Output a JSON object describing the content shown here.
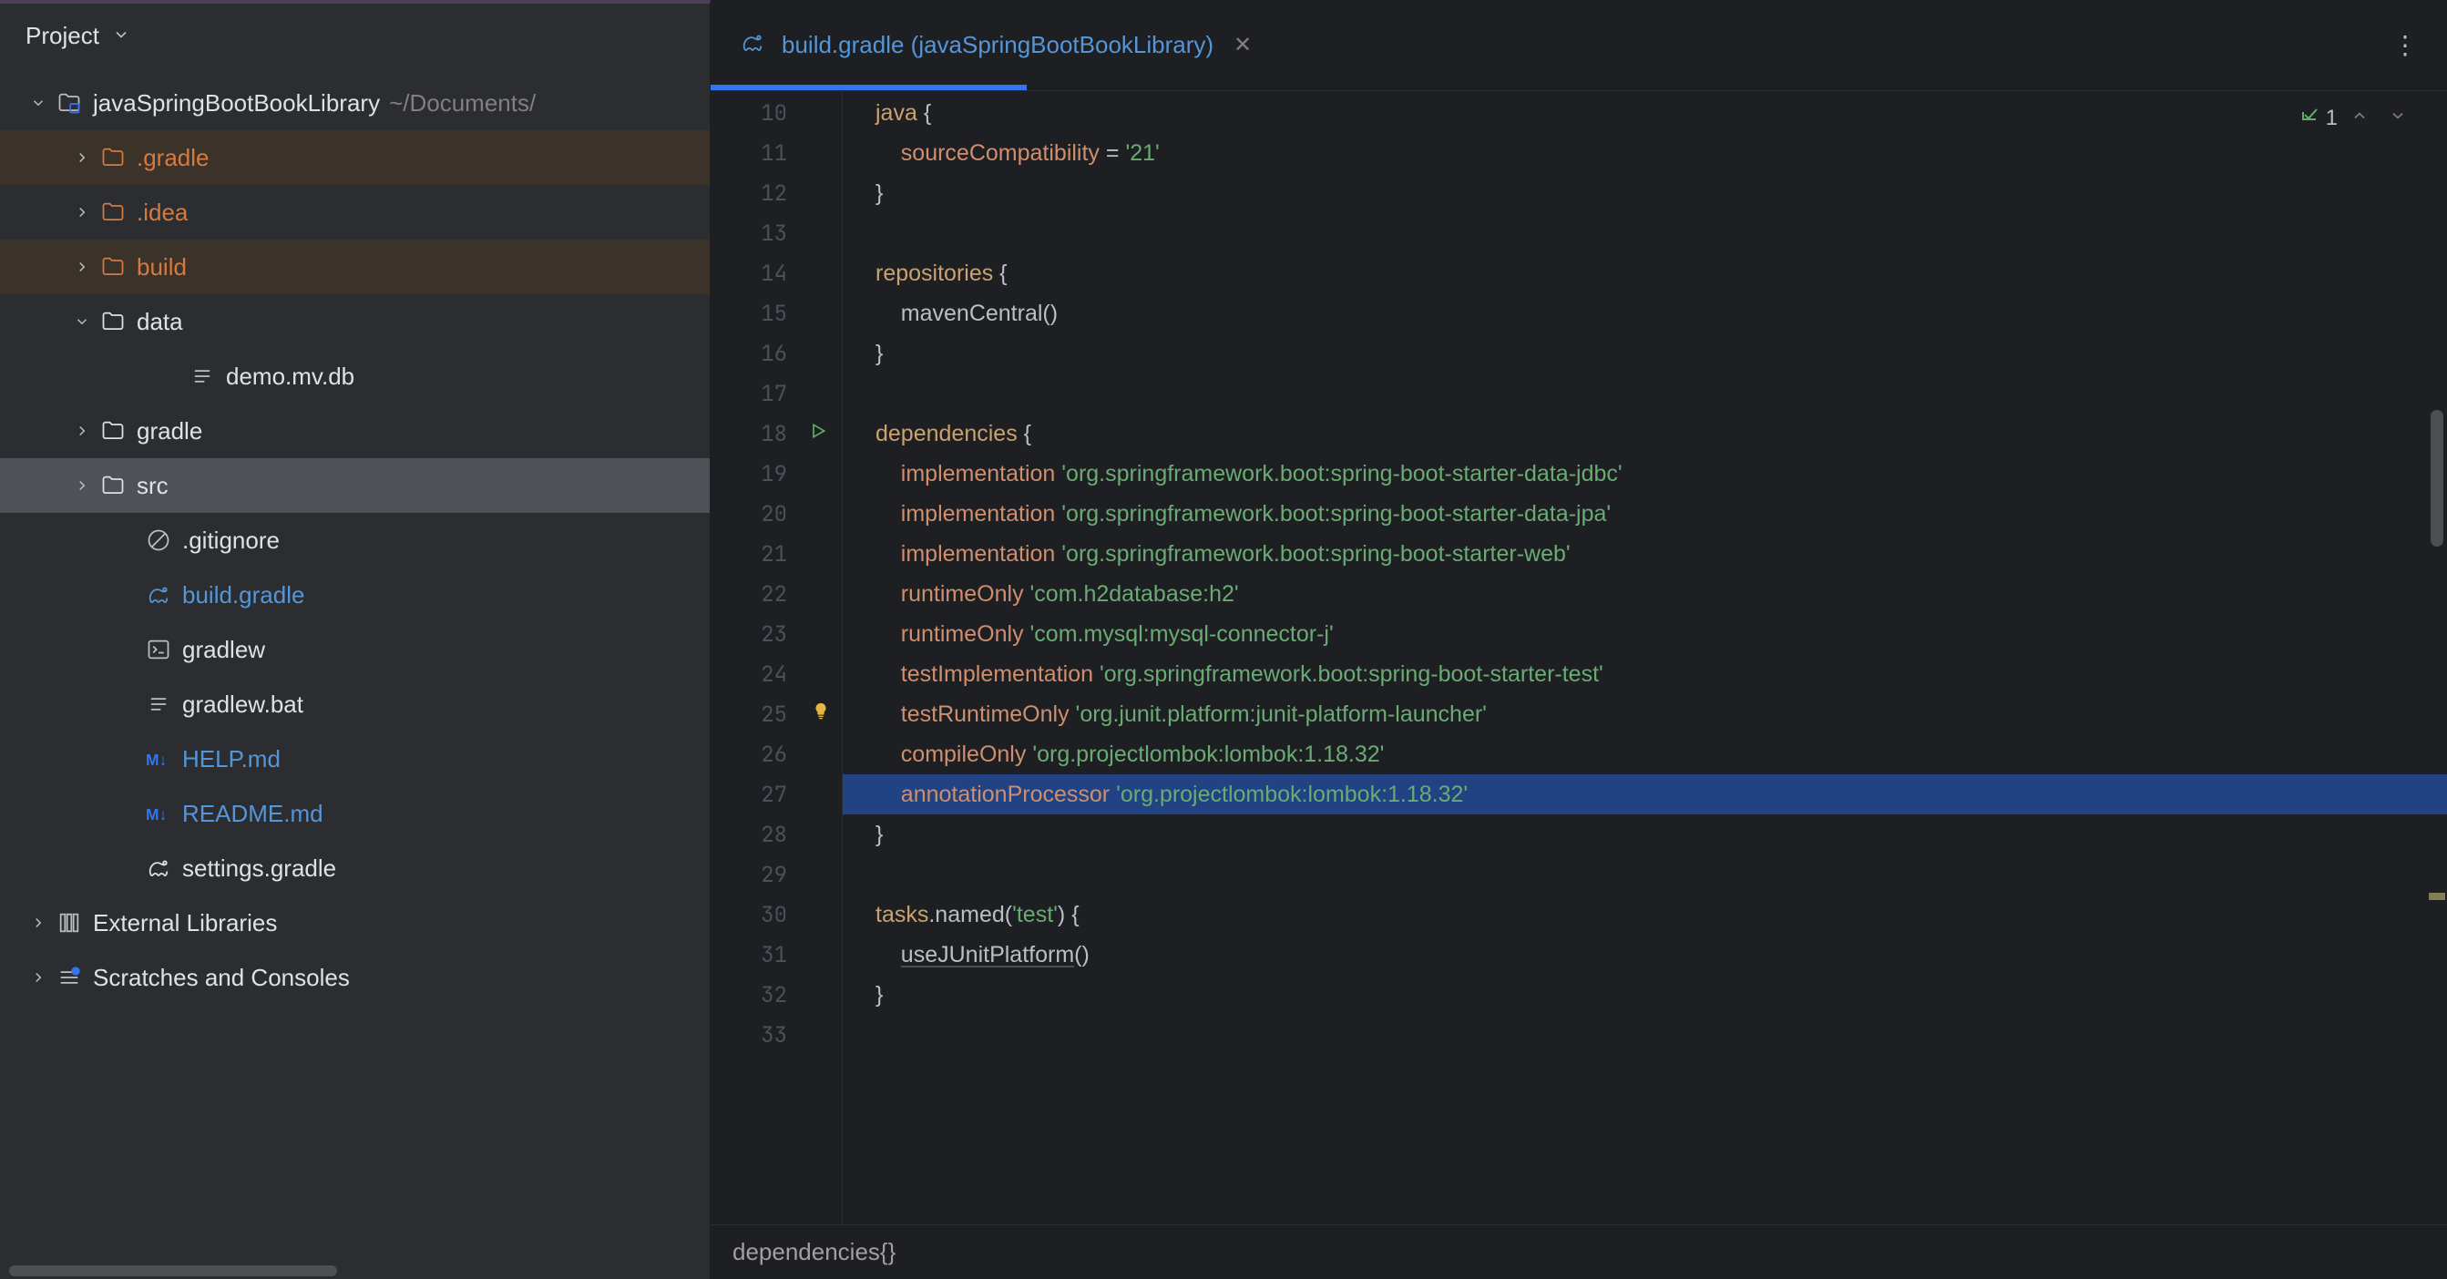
{
  "sidebar": {
    "title": "Project",
    "tree": {
      "root": {
        "name": "javaSpringBootBookLibrary",
        "path": "~/Documents/"
      },
      "items": [
        {
          "name": ".gradle",
          "icon": "folder",
          "class": "item-orange",
          "indent": 1,
          "expand": "closed",
          "highlight": 1
        },
        {
          "name": ".idea",
          "icon": "folder",
          "class": "item-orange",
          "indent": 1,
          "expand": "closed",
          "highlight": 0
        },
        {
          "name": "build",
          "icon": "folder",
          "class": "item-orange",
          "indent": 1,
          "expand": "closed",
          "highlight": 1
        },
        {
          "name": "data",
          "icon": "folder",
          "class": "item-default",
          "indent": 1,
          "expand": "open",
          "highlight": 0
        },
        {
          "name": "demo.mv.db",
          "icon": "file-text",
          "class": "item-default",
          "indent": 3,
          "expand": "none",
          "highlight": 0
        },
        {
          "name": "gradle",
          "icon": "folder",
          "class": "item-default",
          "indent": 1,
          "expand": "closed",
          "highlight": 0
        },
        {
          "name": "src",
          "icon": "folder",
          "class": "item-default",
          "indent": 1,
          "expand": "closed",
          "highlight": 0,
          "selected": true
        },
        {
          "name": ".gitignore",
          "icon": "gitignore",
          "class": "item-default",
          "indent": 2,
          "expand": "none",
          "highlight": 0
        },
        {
          "name": "build.gradle",
          "icon": "gradle",
          "class": "item-blue",
          "indent": 2,
          "expand": "none",
          "highlight": 0
        },
        {
          "name": "gradlew",
          "icon": "terminal",
          "class": "item-default",
          "indent": 2,
          "expand": "none",
          "highlight": 0
        },
        {
          "name": "gradlew.bat",
          "icon": "file-text",
          "class": "item-default",
          "indent": 2,
          "expand": "none",
          "highlight": 0
        },
        {
          "name": "HELP.md",
          "icon": "markdown",
          "class": "item-blue",
          "indent": 2,
          "expand": "none",
          "highlight": 0
        },
        {
          "name": "README.md",
          "icon": "markdown",
          "class": "item-blue",
          "indent": 2,
          "expand": "none",
          "highlight": 0
        },
        {
          "name": "settings.gradle",
          "icon": "gradle",
          "class": "item-default",
          "indent": 2,
          "expand": "none",
          "highlight": 0
        }
      ],
      "external": "External Libraries",
      "scratches": "Scratches and Consoles"
    }
  },
  "editor": {
    "tab": {
      "label": "build.gradle (javaSpringBootBookLibrary)"
    },
    "problems": {
      "count": "1"
    },
    "breadcrumb": "dependencies{}",
    "lines": [
      {
        "num": 10,
        "tokens": [
          [
            "id",
            "java"
          ],
          [
            "op",
            " {"
          ]
        ]
      },
      {
        "num": 11,
        "tokens": [
          [
            "op",
            "    "
          ],
          [
            "kw",
            "sourceCompatibility"
          ],
          [
            "op",
            " = "
          ],
          [
            "str",
            "'21'"
          ]
        ]
      },
      {
        "num": 12,
        "tokens": [
          [
            "op",
            "}"
          ]
        ]
      },
      {
        "num": 13,
        "tokens": []
      },
      {
        "num": 14,
        "tokens": [
          [
            "id",
            "repositories"
          ],
          [
            "op",
            " {"
          ]
        ]
      },
      {
        "num": 15,
        "tokens": [
          [
            "op",
            "    mavenCentral()"
          ]
        ]
      },
      {
        "num": 16,
        "tokens": [
          [
            "op",
            "}"
          ]
        ]
      },
      {
        "num": 17,
        "tokens": []
      },
      {
        "num": 18,
        "tokens": [
          [
            "id",
            "dependencies"
          ],
          [
            "op",
            " {"
          ]
        ],
        "run": true
      },
      {
        "num": 19,
        "tokens": [
          [
            "op",
            "    "
          ],
          [
            "kw",
            "implementation"
          ],
          [
            "op",
            " "
          ],
          [
            "str",
            "'org.springframework.boot:spring-boot-starter-data-jdbc'"
          ]
        ]
      },
      {
        "num": 20,
        "tokens": [
          [
            "op",
            "    "
          ],
          [
            "kw",
            "implementation"
          ],
          [
            "op",
            " "
          ],
          [
            "str",
            "'org.springframework.boot:spring-boot-starter-data-jpa'"
          ]
        ]
      },
      {
        "num": 21,
        "tokens": [
          [
            "op",
            "    "
          ],
          [
            "kw",
            "implementation"
          ],
          [
            "op",
            " "
          ],
          [
            "str",
            "'org.springframework.boot:spring-boot-starter-web'"
          ]
        ]
      },
      {
        "num": 22,
        "tokens": [
          [
            "op",
            "    "
          ],
          [
            "kw",
            "runtimeOnly"
          ],
          [
            "op",
            " "
          ],
          [
            "str",
            "'com.h2database:h2'"
          ]
        ]
      },
      {
        "num": 23,
        "tokens": [
          [
            "op",
            "    "
          ],
          [
            "kw",
            "runtimeOnly"
          ],
          [
            "op",
            " "
          ],
          [
            "str",
            "'com.mysql:mysql-connector-j'"
          ]
        ]
      },
      {
        "num": 24,
        "tokens": [
          [
            "op",
            "    "
          ],
          [
            "kw",
            "testImplementation"
          ],
          [
            "op",
            " "
          ],
          [
            "str",
            "'org.springframework.boot:spring-boot-starter-test'"
          ]
        ]
      },
      {
        "num": 25,
        "tokens": [
          [
            "op",
            "    "
          ],
          [
            "kw",
            "testRuntimeOnly"
          ],
          [
            "op",
            " "
          ],
          [
            "str",
            "'org.junit.platform:junit-platform-launcher'"
          ]
        ],
        "hint": true
      },
      {
        "num": 26,
        "tokens": [
          [
            "op",
            "    "
          ],
          [
            "kw",
            "compileOnly"
          ],
          [
            "op",
            " "
          ],
          [
            "str",
            "'org.projectlombok:lombok:1.18.32'"
          ]
        ]
      },
      {
        "num": 27,
        "tokens": [
          [
            "op",
            "    "
          ],
          [
            "kw",
            "annotationProcessor"
          ],
          [
            "op",
            " "
          ],
          [
            "str",
            "'org.projectlombok:lombok:1.18.32'"
          ]
        ],
        "hl": true
      },
      {
        "num": 28,
        "tokens": [
          [
            "op",
            "}"
          ]
        ]
      },
      {
        "num": 29,
        "tokens": []
      },
      {
        "num": 30,
        "tokens": [
          [
            "id",
            "tasks"
          ],
          [
            "op",
            ".named("
          ],
          [
            "str",
            "'test'"
          ],
          [
            "op",
            ") {"
          ]
        ]
      },
      {
        "num": 31,
        "tokens": [
          [
            "op",
            "    "
          ],
          [
            "ul",
            "useJUnitPlatform"
          ],
          [
            "op",
            "()"
          ]
        ]
      },
      {
        "num": 32,
        "tokens": [
          [
            "op",
            "}"
          ]
        ]
      },
      {
        "num": 33,
        "tokens": []
      }
    ]
  }
}
